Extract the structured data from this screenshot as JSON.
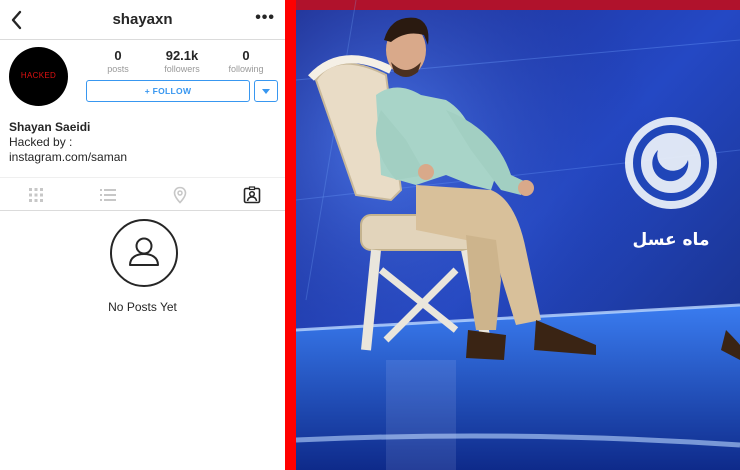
{
  "profile": {
    "username": "shayaxn",
    "more_label": "•••",
    "avatar_text": "HACKED",
    "stats": [
      {
        "value": "0",
        "label": "posts"
      },
      {
        "value": "92.1k",
        "label": "followers"
      },
      {
        "value": "0",
        "label": "following"
      }
    ],
    "follow_label": "+ FOLLOW",
    "full_name": "Shayan Saeidi",
    "bio_lines": [
      "Hacked by :",
      "instagram.com/saman"
    ],
    "tabs": [
      "grid-icon",
      "list-icon",
      "location-pin-icon",
      "tagged-person-icon"
    ],
    "empty_state": "No Posts Yet"
  },
  "photo": {
    "logo_text": "ماه عسل"
  },
  "colors": {
    "accent": "#3897f0",
    "divider": "#ff0000",
    "studio_blue": "#1a3fb0"
  }
}
